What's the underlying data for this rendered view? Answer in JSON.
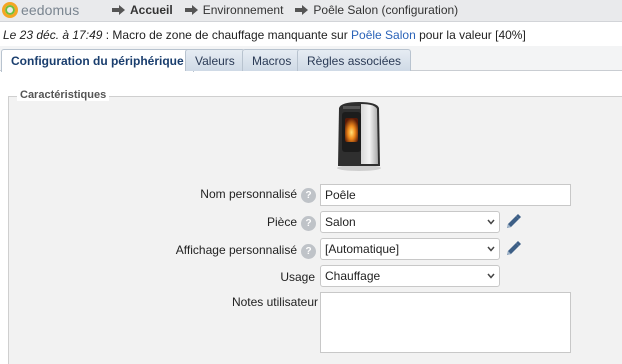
{
  "app": {
    "logo_text": "eedomus"
  },
  "breadcrumb": [
    {
      "label": "Accueil"
    },
    {
      "label": "Environnement"
    },
    {
      "label": "Poêle Salon (configuration)"
    }
  ],
  "notice": {
    "when": "Le 23 déc. à 17:49",
    "message_before": " : Macro de zone de chauffage manquante sur ",
    "link": "Poêle Salon",
    "message_after": " pour la valeur [40%]"
  },
  "tabs": [
    {
      "label": "Configuration du périphérique",
      "active": true
    },
    {
      "label": "Valeurs"
    },
    {
      "label": "Macros"
    },
    {
      "label": "Règles associées"
    }
  ],
  "section": {
    "legend": "Caractéristiques"
  },
  "form": {
    "name_label": "Nom personnalisé",
    "name_value": "Poêle",
    "room_label": "Pièce",
    "room_value": "Salon",
    "display_label": "Affichage personnalisé",
    "display_value": "[Automatique]",
    "usage_label": "Usage",
    "usage_value": "Chauffage",
    "notes_label": "Notes utilisateur",
    "notes_value": "",
    "help_glyph": "?"
  },
  "icons": {
    "help": "question-icon",
    "edit": "pencil-icon",
    "dropdown": "chevron-down-icon",
    "breadcrumb": "arrow-right-icon"
  }
}
